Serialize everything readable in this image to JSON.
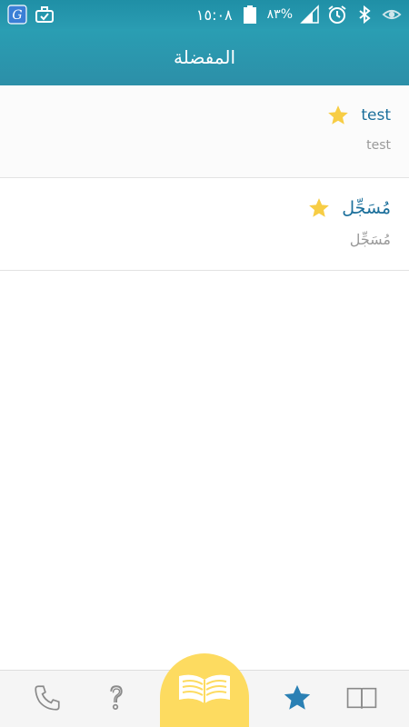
{
  "status_bar": {
    "battery": "٨٣%",
    "time": "١٥:٠٨",
    "icons": [
      "g-app-icon",
      "briefcase-icon",
      "eye-icon",
      "bluetooth-icon",
      "alarm-icon",
      "signal-icon",
      "battery-icon"
    ]
  },
  "header": {
    "title": "المفضلة"
  },
  "favorites": [
    {
      "word": "test",
      "translation": "test",
      "starred": true
    },
    {
      "word": "مُسَجِّل",
      "translation": "مُسَجِّل",
      "starred": true
    }
  ],
  "bottom_nav": {
    "items": [
      "phone-icon",
      "help-icon",
      "dictionary-book-icon",
      "star-icon",
      "book-icon"
    ]
  },
  "colors": {
    "header": "#2a9cb2",
    "accent_blue": "#1b6f9b",
    "star": "#f7cd45",
    "fab": "#fddb60",
    "nav_star": "#2a80b4"
  }
}
